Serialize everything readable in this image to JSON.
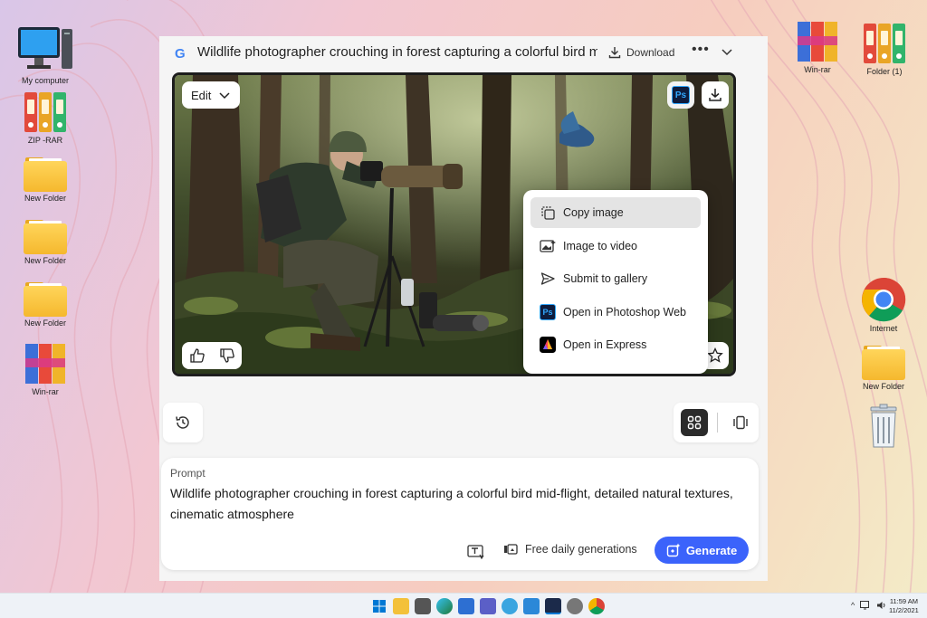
{
  "desktop": {
    "left_icons": [
      {
        "label": "My computer",
        "icon": "computer-icon"
      },
      {
        "label": "ZIP -RAR",
        "icon": "binders-icon"
      },
      {
        "label": "New Folder",
        "icon": "folder-icon"
      },
      {
        "label": "New Folder",
        "icon": "folder-icon"
      },
      {
        "label": "New Folder",
        "icon": "folder-icon"
      },
      {
        "label": "Win-rar",
        "icon": "winrar-icon"
      }
    ],
    "right_icons": [
      {
        "label": "Win-rar",
        "icon": "winrar-icon"
      },
      {
        "label": "Folder (1)",
        "icon": "binders-icon"
      },
      {
        "label": "Internet",
        "icon": "chrome-icon"
      },
      {
        "label": "New Folder",
        "icon": "folder-icon"
      },
      {
        "label": "",
        "icon": "recycle-bin-icon"
      }
    ]
  },
  "app": {
    "title": "Wildlife photographer crouching in forest capturing a colorful bird mid-flight, detailed natural textures, cinematic atmosphere",
    "download_label": "Download",
    "more_label": "•••",
    "image_toolbar": {
      "edit_label": "Edit",
      "ps_label": "Ps"
    },
    "context_menu": [
      {
        "label": "Copy image",
        "icon": "copy-icon"
      },
      {
        "label": "Image to video",
        "icon": "video-icon"
      },
      {
        "label": "Submit to gallery",
        "icon": "send-icon"
      },
      {
        "label": "Open in Photoshop Web",
        "icon": "photoshop-icon"
      },
      {
        "label": "Open in Express",
        "icon": "express-icon"
      }
    ],
    "prompt": {
      "label": "Prompt",
      "text": "Wildlife photographer crouching in forest capturing a colorful bird mid-flight, detailed natural textures, cinematic atmosphere"
    },
    "free_generations_label": "Free daily generations",
    "generate_label": "Generate"
  },
  "taskbar": {
    "time": "11:59 AM",
    "date": "11/2/2021",
    "tray_chevron": "^"
  },
  "colors": {
    "accent": "#3b63fb",
    "window_bg": "#f5f5f5"
  }
}
